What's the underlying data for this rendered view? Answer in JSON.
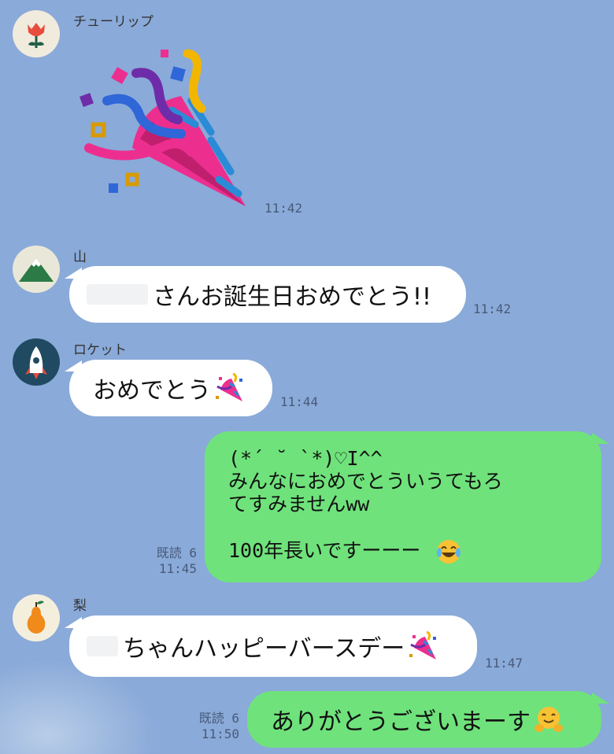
{
  "messages": [
    {
      "sender": "チューリップ",
      "type": "sticker",
      "sticker": "party-popper",
      "time": "11:42"
    },
    {
      "sender": "山",
      "text": "さんお誕生日おめでとう!!",
      "time": "11:42"
    },
    {
      "sender": "ロケット",
      "text": "おめでとう",
      "emoji": "party-popper",
      "time": "11:44"
    },
    {
      "sender": "me",
      "lines": [
        "(*´ ˘ `*)♡I^^",
        "みんなにおめでとういうてもろ",
        "てすみませんww",
        "",
        "100年長いですーーー"
      ],
      "emoji": "joy-emoji",
      "read": "既読 6",
      "time": "11:45"
    },
    {
      "sender": "梨",
      "text": "ちゃんハッピーバースデー",
      "emoji": "party-popper",
      "time": "11:47"
    },
    {
      "sender": "me",
      "text": "ありがとうございまーす",
      "emoji": "hugging-face",
      "read": "既読 6",
      "time": "11:50"
    }
  ],
  "colors": {
    "background": "#8aaad9",
    "incoming_bubble": "#ffffff",
    "outgoing_bubble": "#6fe27b"
  }
}
